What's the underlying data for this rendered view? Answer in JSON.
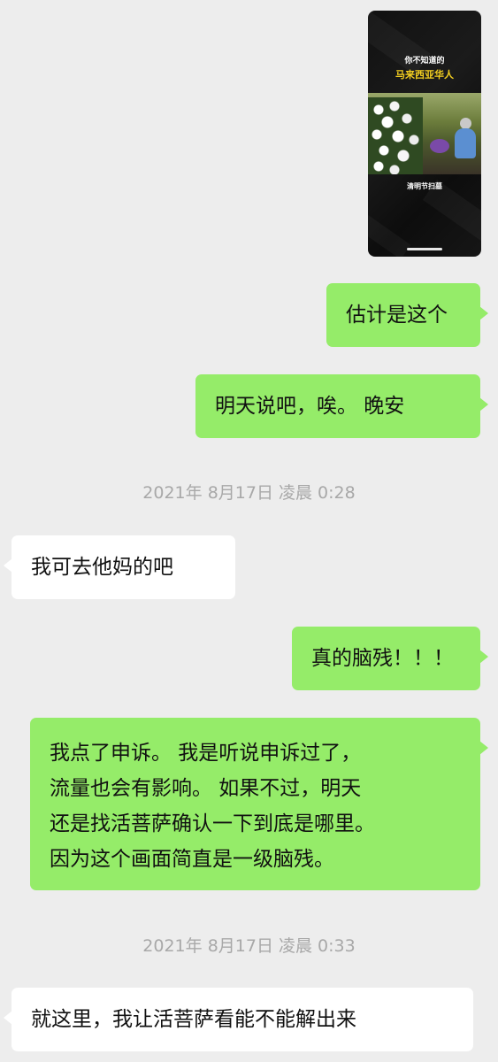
{
  "video": {
    "title_line1": "你不知道的",
    "title_line2": "马来西亚华人",
    "caption": "清明节扫墓"
  },
  "messages": [
    {
      "side": "sent",
      "text": "估计是这个"
    },
    {
      "side": "sent",
      "text": "明天说吧，唉。 晚安"
    },
    {
      "side": "received",
      "text": "我可去他妈的吧"
    },
    {
      "side": "sent",
      "text": "真的脑残！！！"
    },
    {
      "side": "sent",
      "lines": [
        "我点了申诉。 我是听说申诉过了，",
        "流量也会有影响。 如果不过，明天",
        "还是找活菩萨确认一下到底是哪里。",
        "因为这个画面简直是一级脑残。"
      ]
    },
    {
      "side": "received",
      "text": "就这里，我让活菩萨看能不能解出来"
    }
  ],
  "timestamps": [
    "2021年 8月17日 凌晨 0:28",
    "2021年 8月17日 凌晨 0:33"
  ]
}
